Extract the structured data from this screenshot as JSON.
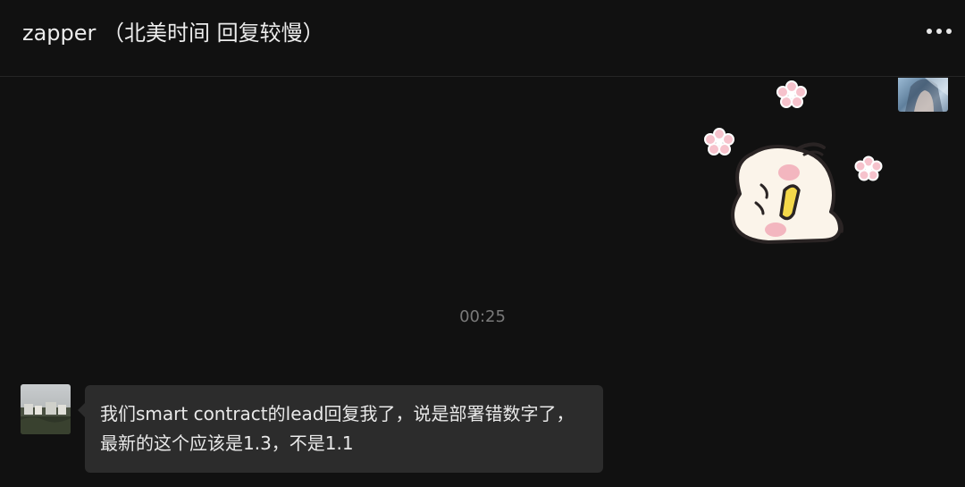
{
  "header": {
    "title": "zapper （北美时间 回复较慢）",
    "more_icon": "more-horizontal-icon"
  },
  "messages": [
    {
      "sender": "self",
      "type": "sticker",
      "sticker_icon": "sticker-chick-lying-icon"
    },
    {
      "type": "timestamp",
      "text": "00:25"
    },
    {
      "sender": "other",
      "type": "text",
      "text": "我们smart contract的lead回复我了，说是部署错数字了，最新的这个应该是1.3，不是1.1"
    }
  ],
  "colors": {
    "background": "#111111",
    "bubble": "#2c2c2c",
    "text": "#e9e9e9",
    "timestamp": "#7a7a7a"
  }
}
